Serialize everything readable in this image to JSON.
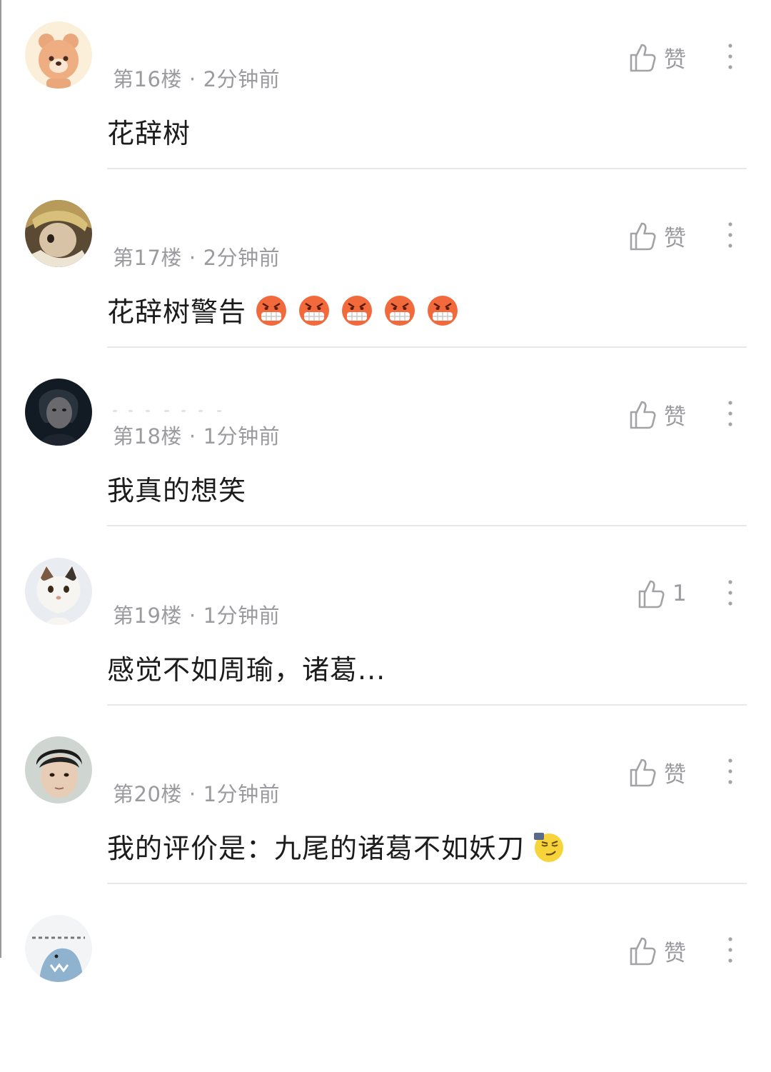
{
  "comments": [
    {
      "floor": "第16楼",
      "time": "2分钟前",
      "text": "花辞树",
      "like": "赞"
    },
    {
      "floor": "第17楼",
      "time": "2分钟前",
      "text": "花辞树警告",
      "like": "赞"
    },
    {
      "floor": "第18楼",
      "time": "1分钟前",
      "text": "我真的想笑",
      "like": "赞"
    },
    {
      "floor": "第19楼",
      "time": "1分钟前",
      "text": "感觉不如周瑜，诸葛...",
      "like": "1"
    },
    {
      "floor": "第20楼",
      "time": "1分钟前",
      "text": "我的评价是：九尾的诸葛不如妖刀",
      "like": "赞"
    },
    {
      "floor": "",
      "time": "",
      "text": "",
      "like": "赞"
    }
  ],
  "separator": "·",
  "icons": {
    "like": "thumbs-up-icon",
    "more": "vertical-ellipsis-icon",
    "angry_emoji": "angry-face-emoji",
    "smirk_emoji": "smug-face-emoji"
  },
  "colors": {
    "meta_text": "#9b9b9f",
    "body_text": "#1c1c1c",
    "divider": "#e8e8ea",
    "angry": "#f26a3c",
    "smirk": "#f7d43a"
  }
}
